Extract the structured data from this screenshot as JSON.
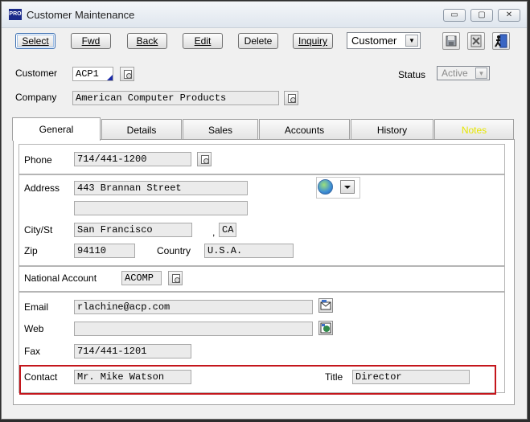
{
  "window": {
    "app_icon_text": "PRO",
    "title": "Customer Maintenance",
    "minimize_glyph": "▭",
    "restore_glyph": "▢",
    "close_glyph": "✕"
  },
  "toolbar": {
    "select_label": "Select",
    "fwd_label": "Fwd",
    "back_label": "Back",
    "edit_label": "Edit",
    "delete_label": "Delete",
    "inquiry_label": "Inquiry",
    "entity_select_value": "Customer",
    "icons": [
      "save-icon",
      "cancel-icon",
      "exit-icon"
    ]
  },
  "header": {
    "customer_label": "Customer",
    "customer_value": "ACP1",
    "company_label": "Company",
    "company_value": "American Computer Products",
    "status_label": "Status",
    "status_value": "Active"
  },
  "tabs": [
    {
      "label": "General",
      "active": true
    },
    {
      "label": "Details"
    },
    {
      "label": "Sales"
    },
    {
      "label": "Accounts"
    },
    {
      "label": "History"
    },
    {
      "label": "Notes",
      "color": "#e6e600"
    }
  ],
  "general": {
    "phone_label": "Phone",
    "phone_value": "714/441-1200",
    "address_label": "Address",
    "address_line1": "443 Brannan Street",
    "address_line2": "",
    "city_label": "City/St",
    "city_value": "San Francisco",
    "state_separator": ",",
    "state_value": "CA",
    "zip_label": "Zip",
    "zip_value": "94110",
    "country_label": "Country",
    "country_value": "U.S.A.",
    "national_account_label": "National Account",
    "national_account_value": "ACOMP",
    "email_label": "Email",
    "email_value": "rlachine@acp.com",
    "web_label": "Web",
    "web_value": "",
    "fax_label": "Fax",
    "fax_value": "714/441-1201",
    "contact_label": "Contact",
    "contact_value": "Mr. Mike Watson",
    "title_label": "Title",
    "title_value": "Director"
  },
  "colors": {
    "highlight_border": "#c4161c",
    "notes_tab_text": "#e6e600",
    "title_icon_bg": "#1b2a8a"
  }
}
